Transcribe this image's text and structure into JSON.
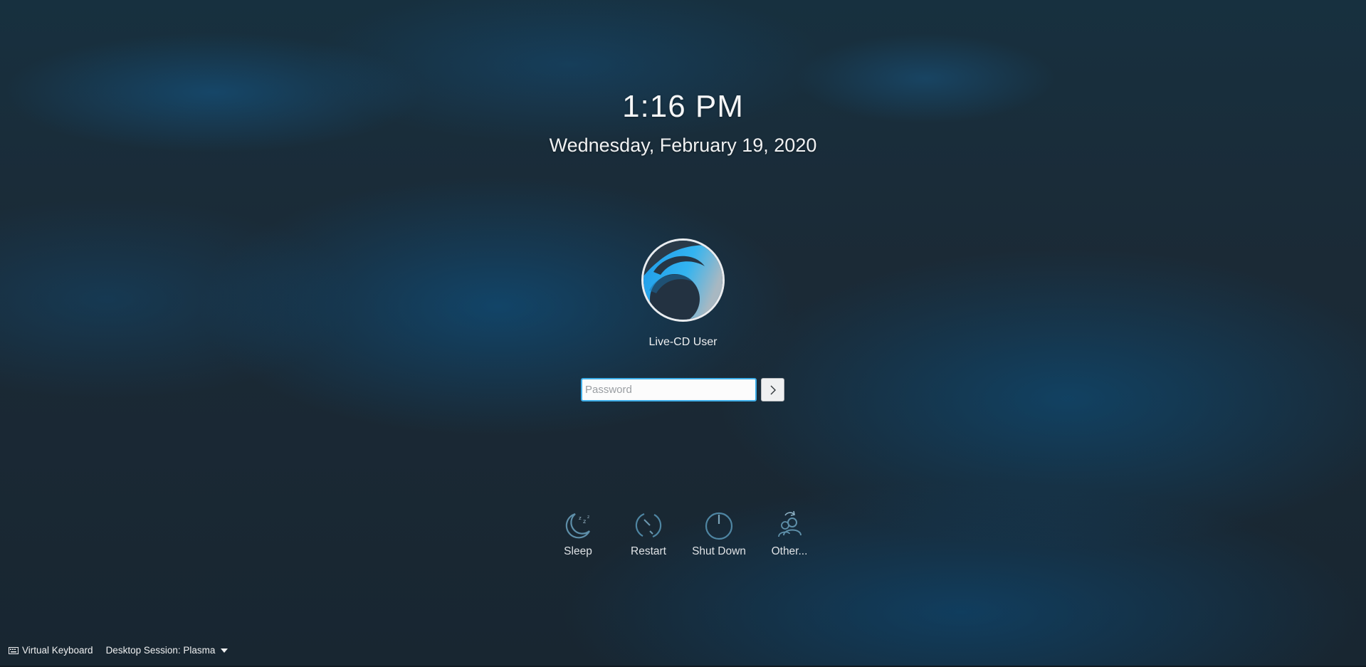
{
  "clock": {
    "time": "1:16 PM",
    "date": "Wednesday, February 19, 2020"
  },
  "user": {
    "name": "Live-CD User"
  },
  "login": {
    "password_placeholder": "Password",
    "submit_icon": "chevron-right-icon"
  },
  "actions": [
    {
      "label": "Sleep",
      "icon": "sleep-icon"
    },
    {
      "label": "Restart",
      "icon": "restart-icon"
    },
    {
      "label": "Shut Down",
      "icon": "power-icon"
    },
    {
      "label": "Other...",
      "icon": "switch-user-icon"
    }
  ],
  "bottom_bar": {
    "virtual_keyboard": "Virtual Keyboard",
    "session": "Desktop Session: Plasma"
  },
  "colors": {
    "accent": "#3daee9",
    "background": "#1a2a36",
    "text": "#eff0f1"
  }
}
